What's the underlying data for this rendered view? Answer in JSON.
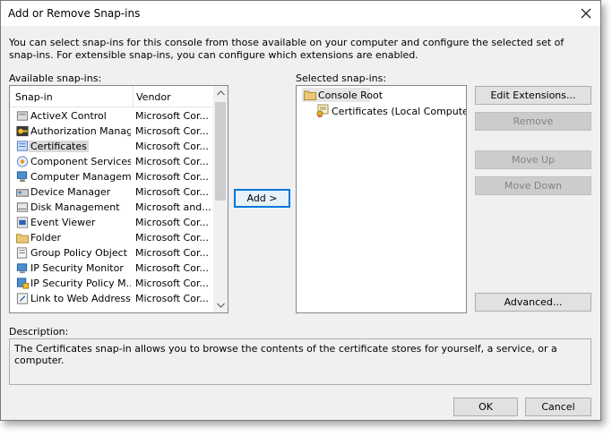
{
  "window": {
    "title": "Add or Remove Snap-ins"
  },
  "intro": "You can select snap-ins for this console from those available on your computer and configure the selected set of snap-ins. For extensible snap-ins, you can configure which extensions are enabled.",
  "available": {
    "label": "Available snap-ins:",
    "columns": {
      "snapin": "Snap-in",
      "vendor": "Vendor"
    },
    "items": [
      {
        "name": "ActiveX Control",
        "vendor": "Microsoft Cor...",
        "icon": "activex-icon"
      },
      {
        "name": "Authorization Manager",
        "vendor": "Microsoft Cor...",
        "icon": "authorization-icon"
      },
      {
        "name": "Certificates",
        "vendor": "Microsoft Cor...",
        "icon": "certificates-icon"
      },
      {
        "name": "Component Services",
        "vendor": "Microsoft Cor...",
        "icon": "component-services-icon"
      },
      {
        "name": "Computer Managem...",
        "vendor": "Microsoft Cor...",
        "icon": "computer-management-icon"
      },
      {
        "name": "Device Manager",
        "vendor": "Microsoft Cor...",
        "icon": "device-manager-icon"
      },
      {
        "name": "Disk Management",
        "vendor": "Microsoft and...",
        "icon": "disk-management-icon"
      },
      {
        "name": "Event Viewer",
        "vendor": "Microsoft Cor...",
        "icon": "event-viewer-icon"
      },
      {
        "name": "Folder",
        "vendor": "Microsoft Cor...",
        "icon": "folder-icon"
      },
      {
        "name": "Group Policy Object ...",
        "vendor": "Microsoft Cor...",
        "icon": "group-policy-icon"
      },
      {
        "name": "IP Security Monitor",
        "vendor": "Microsoft Cor...",
        "icon": "ip-security-monitor-icon"
      },
      {
        "name": "IP Security Policy M...",
        "vendor": "Microsoft Cor...",
        "icon": "ip-security-policy-icon"
      },
      {
        "name": "Link to Web Address",
        "vendor": "Microsoft Cor...",
        "icon": "link-icon"
      }
    ],
    "selected_index": 2
  },
  "add_button": "Add >",
  "selected": {
    "label": "Selected snap-ins:",
    "root": "Console Root",
    "child": "Certificates (Local Computer)"
  },
  "buttons": {
    "edit_extensions": "Edit Extensions...",
    "remove": "Remove",
    "move_up": "Move Up",
    "move_down": "Move Down",
    "advanced": "Advanced...",
    "ok": "OK",
    "cancel": "Cancel"
  },
  "description": {
    "label": "Description:",
    "text": "The Certificates snap-in allows you to browse the contents of the certificate stores for yourself, a service, or a computer."
  },
  "colors": {
    "focus": "#0078d7",
    "face": "#f0f0f0",
    "disabled_text": "#838383"
  }
}
